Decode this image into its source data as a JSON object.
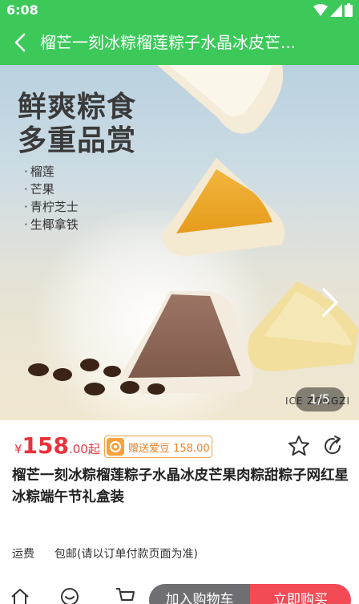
{
  "status_bar": {
    "time": "6:08",
    "icons": [
      "wifi-icon",
      "signal-icon",
      "battery-icon"
    ]
  },
  "header": {
    "title": "榴芒一刻冰粽榴莲粽子水晶冰皮芒..."
  },
  "gallery": {
    "headline_line1": "鲜爽粽食",
    "headline_line2": "多重品赏",
    "flavors": [
      "榴莲",
      "芒果",
      "青柠芝士",
      "生椰拿铁"
    ],
    "watermark": "ICE ZONGZI",
    "page_indicator": "1/5"
  },
  "price": {
    "currency": "¥",
    "integer": "158",
    "decimal": ".00",
    "suffix": "起"
  },
  "badge": {
    "text": "赠送爱豆 158.00"
  },
  "product": {
    "name": "榴芒一刻冰粽榴莲粽子水晶冰皮芒果肉粽甜粽子网红星冰粽端午节礼盒装"
  },
  "shipping": {
    "label": "运费",
    "value": "包邮(请以订单付款页面为准)"
  },
  "bottom_bar": {
    "add_to_cart": "加入购物车",
    "buy_now": "立即购买"
  },
  "colors": {
    "brand_green": "#3cc95a",
    "price_red": "#e8323c",
    "buy_red": "#f24b55",
    "cart_gray": "#6f6f73",
    "badge_orange": "#f2a44a"
  }
}
